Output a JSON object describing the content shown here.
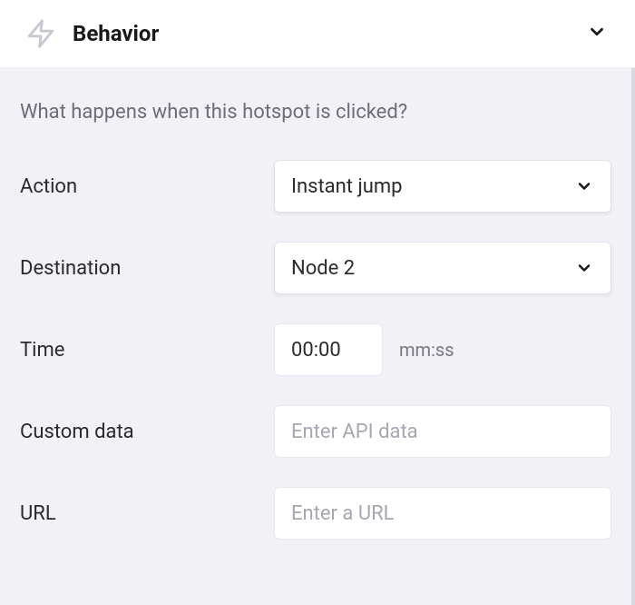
{
  "header": {
    "title": "Behavior"
  },
  "body": {
    "description": "What happens when this hotspot is clicked?",
    "fields": {
      "action": {
        "label": "Action",
        "value": "Instant jump"
      },
      "destination": {
        "label": "Destination",
        "value": "Node 2"
      },
      "time": {
        "label": "Time",
        "value": "00:00",
        "unit": "mm:ss"
      },
      "customData": {
        "label": "Custom data",
        "placeholder": "Enter API data"
      },
      "url": {
        "label": "URL",
        "placeholder": "Enter a URL"
      }
    }
  }
}
